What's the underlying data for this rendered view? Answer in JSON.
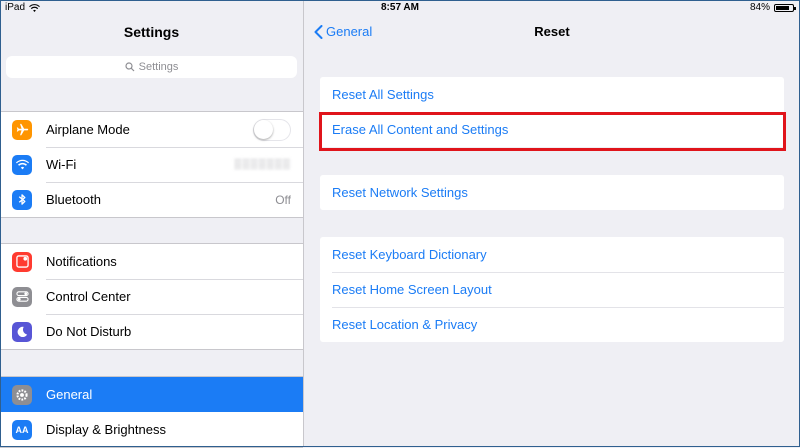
{
  "status_bar": {
    "device": "iPad",
    "time": "8:57 AM",
    "battery_text": "84%",
    "battery_level": 0.84
  },
  "sidebar": {
    "title": "Settings",
    "search_placeholder": "Settings",
    "groups": [
      [
        {
          "label": "Airplane Mode",
          "icon": "airplane-icon",
          "color": "#ff9500",
          "accessory": "toggle-off"
        },
        {
          "label": "Wi-Fi",
          "icon": "wifi-icon",
          "color": "#1b7cf5"
        },
        {
          "label": "Bluetooth",
          "icon": "bluetooth-icon",
          "color": "#1b7cf5",
          "value": "Off"
        }
      ],
      [
        {
          "label": "Notifications",
          "icon": "notifications-icon",
          "color": "#ff3b30"
        },
        {
          "label": "Control Center",
          "icon": "control-center-icon",
          "color": "#8e8e93"
        },
        {
          "label": "Do Not Disturb",
          "icon": "moon-icon",
          "color": "#5856d6"
        }
      ],
      [
        {
          "label": "General",
          "icon": "gear-icon",
          "color": "#8e8e93",
          "selected": true
        },
        {
          "label": "Display & Brightness",
          "icon": "display-icon",
          "color": "#1b7cf5",
          "glyph": "AA"
        }
      ]
    ]
  },
  "detail": {
    "back_label": "General",
    "title": "Reset",
    "groups": [
      [
        "Reset All Settings",
        "Erase All Content and Settings"
      ],
      [
        "Reset Network Settings"
      ],
      [
        "Reset Keyboard Dictionary",
        "Reset Home Screen Layout",
        "Reset Location & Privacy"
      ]
    ]
  },
  "colors": {
    "accent": "#1b7cf5",
    "highlight": "#e0141b",
    "background": "#efeff4"
  }
}
